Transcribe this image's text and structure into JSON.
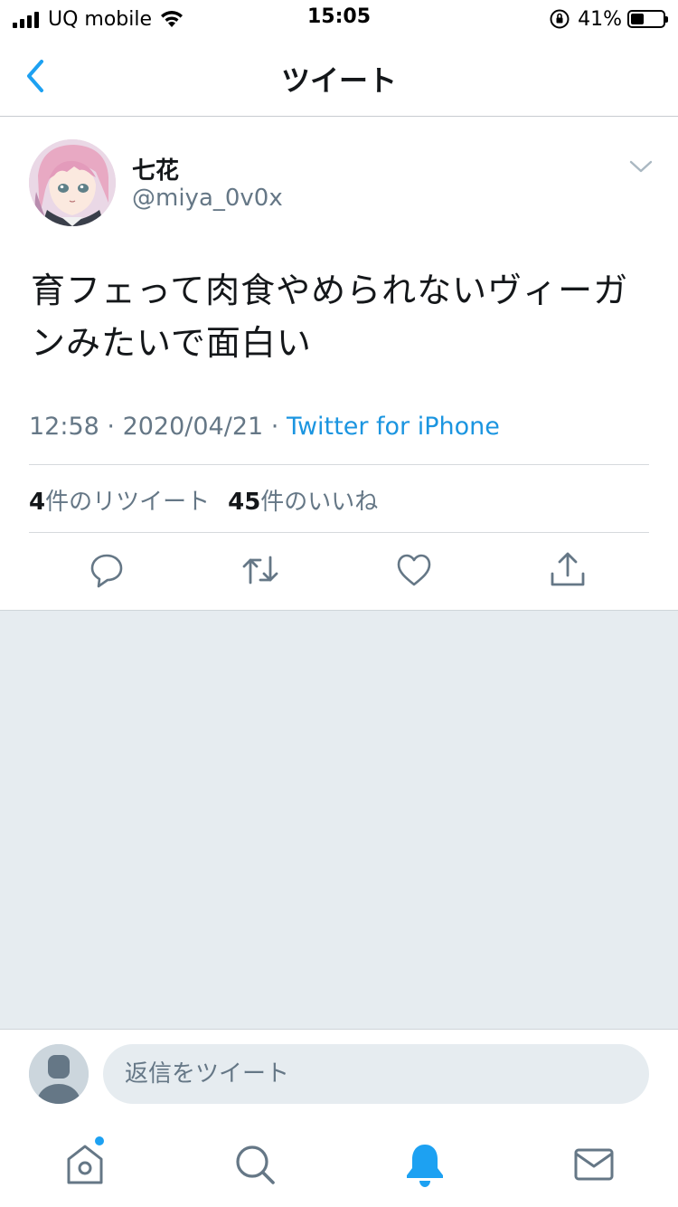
{
  "status_bar": {
    "carrier": "UQ mobile",
    "time": "15:05",
    "battery_percent": "41%",
    "battery_level": 0.41
  },
  "nav": {
    "title": "ツイート",
    "back_icon": "chevron-left-icon"
  },
  "tweet": {
    "user": {
      "display_name": "七花",
      "handle": "@miya_0v0x"
    },
    "text": "育フェって肉食やめられないヴィーガンみたいで面白い",
    "time": "12:58",
    "separator": " · ",
    "date": "2020/04/21",
    "source": "Twitter for iPhone",
    "retweet_count": "4",
    "retweet_label": "件のリツイート",
    "like_count": "45",
    "like_label": "件のいいね",
    "actions": [
      {
        "name": "reply",
        "icon": "reply-icon"
      },
      {
        "name": "retweet",
        "icon": "retweet-icon"
      },
      {
        "name": "like",
        "icon": "heart-icon"
      },
      {
        "name": "share",
        "icon": "share-icon"
      }
    ]
  },
  "reply_bar": {
    "placeholder": "返信をツイート"
  },
  "tab_bar": {
    "tabs": [
      {
        "name": "home",
        "icon": "home-icon",
        "has_badge": true
      },
      {
        "name": "search",
        "icon": "search-icon"
      },
      {
        "name": "notifications",
        "icon": "bell-icon",
        "active": true
      },
      {
        "name": "messages",
        "icon": "mail-icon"
      }
    ]
  },
  "colors": {
    "accent": "#1da1f2",
    "link": "#1b95e0",
    "text_primary": "#14171a",
    "text_secondary": "#657786",
    "background_gray": "#e6ecf0"
  }
}
